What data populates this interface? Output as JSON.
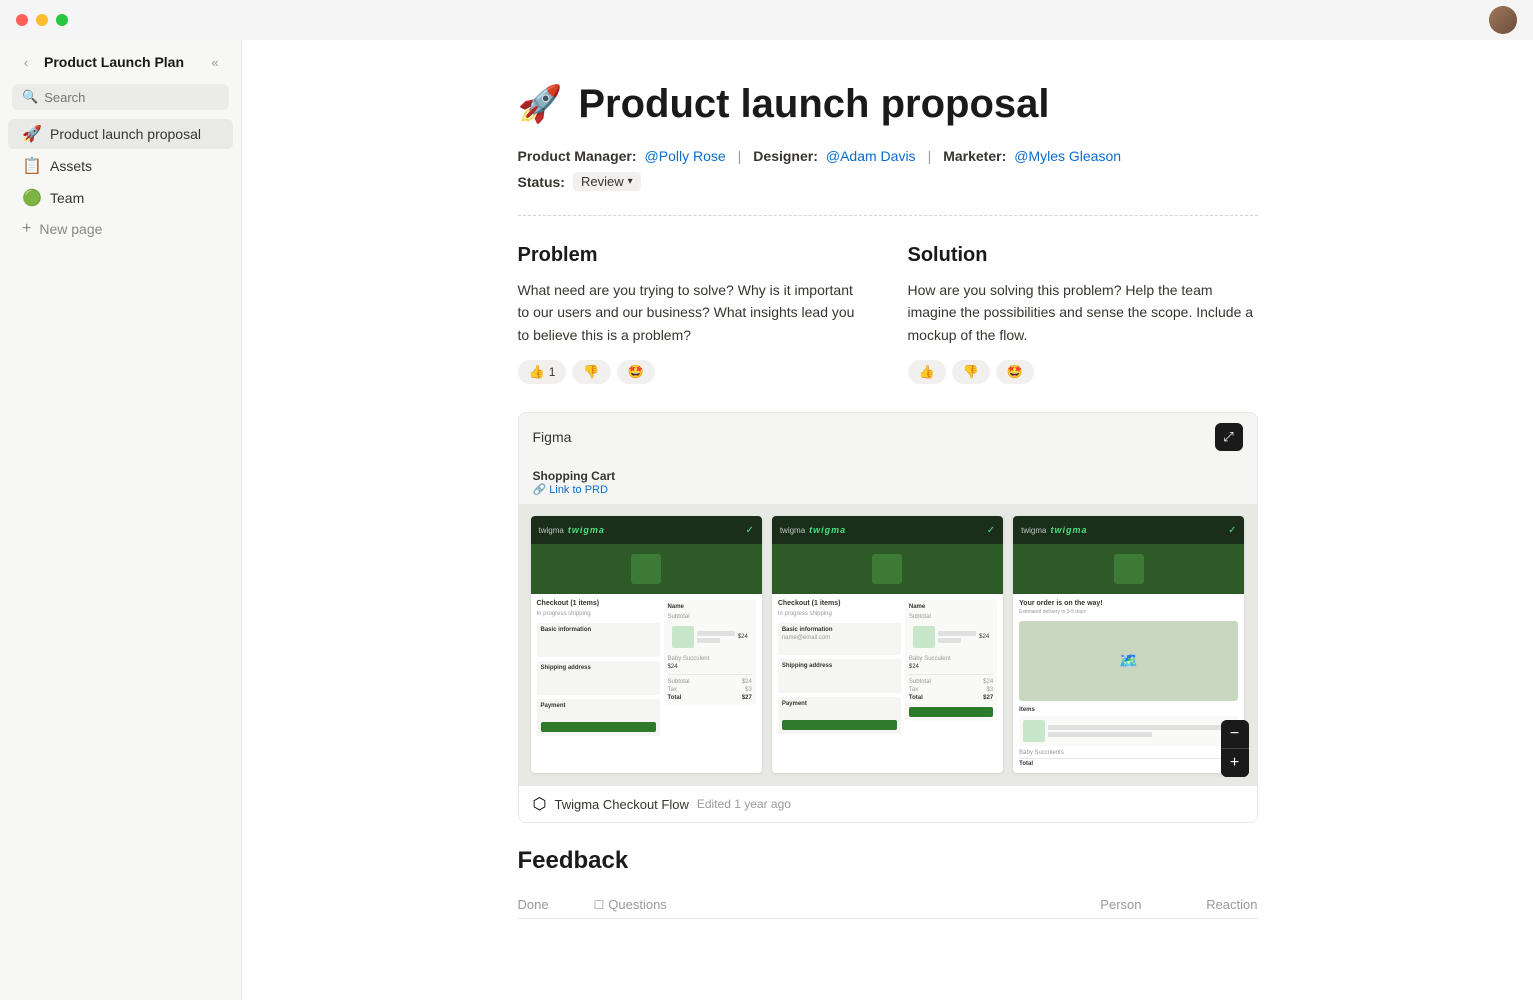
{
  "titlebar": {
    "traffic_lights": [
      "red",
      "yellow",
      "green"
    ]
  },
  "sidebar": {
    "title": "Product Launch Plan",
    "search_placeholder": "Search",
    "nav_items": [
      {
        "id": "product-launch",
        "label": "Product launch proposal",
        "icon": "🚀",
        "active": true
      },
      {
        "id": "assets",
        "label": "Assets",
        "icon": "📋",
        "active": false
      },
      {
        "id": "team",
        "label": "Team",
        "icon": "🟢",
        "active": false
      }
    ],
    "new_page_label": "New page",
    "collapse_icon": "«"
  },
  "main": {
    "page_emoji": "🚀",
    "page_title": "Product launch proposal",
    "metadata": {
      "product_manager_label": "Product Manager:",
      "product_manager_value": "@Polly Rose",
      "designer_label": "Designer:",
      "designer_value": "@Adam Davis",
      "marketer_label": "Marketer:",
      "marketer_value": "@Myles Gleason"
    },
    "status": {
      "label": "Status:",
      "value": "Review"
    },
    "problem": {
      "heading": "Problem",
      "body": "What need are you trying to solve? Why is it important to our users and our business? What insights lead you to believe this is a problem?",
      "reactions": [
        {
          "emoji": "👍",
          "count": "1"
        },
        {
          "emoji": "👎",
          "count": ""
        },
        {
          "emoji": "🤩",
          "count": ""
        }
      ]
    },
    "solution": {
      "heading": "Solution",
      "body": "How are you solving this problem? Help the team imagine the possibilities and sense the scope. Include a mockup of the flow.",
      "reactions": [
        {
          "emoji": "👍",
          "count": ""
        },
        {
          "emoji": "👎",
          "count": ""
        },
        {
          "emoji": "🤩",
          "count": ""
        }
      ]
    },
    "figma_embed": {
      "title": "Figma",
      "expand_icon": "⤢",
      "sub_title": "Shopping Cart",
      "sub_link": "🔗 Link to PRD",
      "footer_icon": "⬡",
      "footer_name": "Twigma Checkout Flow",
      "footer_meta": "Edited 1 year ago",
      "zoom_minus": "−",
      "zoom_plus": "+"
    },
    "feedback": {
      "title": "Feedback",
      "columns": {
        "done": "Done",
        "questions": "Questions",
        "person": "Person",
        "reaction": "Reaction"
      }
    }
  }
}
